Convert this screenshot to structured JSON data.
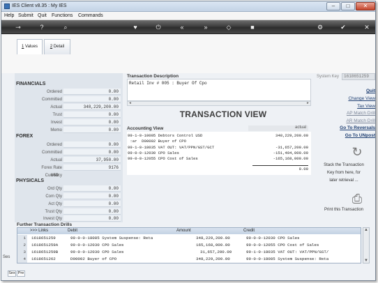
{
  "window": {
    "title": "IES Client v8.35 : My IES"
  },
  "menu": [
    "Help",
    "Submit",
    "Quit",
    "Functions",
    "Commands"
  ],
  "toolbar_icons": [
    "key-icon",
    "help-icon",
    "search-icon",
    "heart-icon",
    "power-icon",
    "rewind-icon",
    "fast-forward-icon",
    "stop-icon",
    "settings-icon",
    "check-icon",
    "close-icon"
  ],
  "tabs": [
    {
      "num": "1",
      "label": "Values",
      "active": true
    },
    {
      "num": "2",
      "label": "Detail",
      "active": false
    }
  ],
  "financials": {
    "heading": "FINANCIALS",
    "fields": [
      {
        "label": "Ordered",
        "value": "0.00"
      },
      {
        "label": "Committed",
        "value": "0.00"
      },
      {
        "label": "Actual",
        "value": "348,229,200.00"
      },
      {
        "label": "Trust",
        "value": "0.00"
      },
      {
        "label": "Invest",
        "value": "0.00"
      },
      {
        "label": "Memo",
        "value": "0.00"
      }
    ]
  },
  "forex": {
    "heading": "FOREX",
    "fields": [
      {
        "label": "Ordered",
        "value": "0.00"
      },
      {
        "label": "Committed",
        "value": "0.00"
      },
      {
        "label": "Actual",
        "value": "37,950.00"
      },
      {
        "label": "Forex Rate",
        "value": "9176"
      },
      {
        "label": "Currency",
        "value": "USD"
      }
    ]
  },
  "physicals": {
    "heading": "PHYSICALS",
    "fields": [
      {
        "label": "Ord Qty",
        "value": "0.00"
      },
      {
        "label": "Com Qty",
        "value": "0.00"
      },
      {
        "label": "Act Qty",
        "value": "0.00"
      },
      {
        "label": "Trust Qty",
        "value": "0.00"
      },
      {
        "label": "Invest Qty",
        "value": "0.00"
      }
    ]
  },
  "transaction": {
    "description_label": "Transaction Description",
    "description": "Retail Inv # 005 : Buyer Of Cpo",
    "view_title": "TRANSACTION VIEW",
    "accounting_label": "Accounting View",
    "actual_header": "actual",
    "lines": [
      {
        "text": "99-1-0-10005 Debtors Control USD",
        "amount": "348,229,200.00"
      },
      {
        "text": " :ar  D00002 Buyer of CPO",
        "amount": ""
      },
      {
        "text": "99-1-0-18035 VAT OUT: VAT/PPN/GST/GCT",
        "amount": "-31,657,200.00"
      },
      {
        "text": "99-0-0-12030 CPO Sales",
        "amount": "-151,404,000.00"
      },
      {
        "text": "99-0-0-12055 CPO Cost of Sales",
        "amount": "-165,168,000.00"
      }
    ],
    "total": "0.00"
  },
  "system_key": {
    "label": "System Key",
    "value": "1618651259"
  },
  "actions": {
    "quit": "Quit",
    "change_view": "Change View",
    "tax_view": "Tax View",
    "ap_match": "AP Match Drill",
    "ar_match": "AR Match Drill",
    "go_reversals": "Go To Reversals",
    "go_unpost": "Go To UNpost",
    "stack_text": [
      "Stack the Transaction",
      "Key from here, for",
      "later retrieval ..."
    ],
    "print_text": "Print this Transaction"
  },
  "drills": {
    "label": "Further Transaction Drills",
    "columns": [
      ">>> Links",
      "Debit",
      "Amount",
      "Credit"
    ],
    "rows": [
      {
        "n": "1",
        "link": "1618651259",
        "debit": "99-0-0-18085 System Suspense: Reta",
        "amount": "348,229,200.00",
        "credit": "99-0-0-12030 CPO Sales"
      },
      {
        "n": "2",
        "link": "1618651259A",
        "debit": "99-0-0-12030 CPO Sales",
        "amount": "165,168,000.00",
        "credit": "99-0-0-12055 CPO Cost of Sales"
      },
      {
        "n": "3",
        "link": "1618651259B",
        "debit": "99-0-0-12030 CPO Sales",
        "amount": "31,657,200.00",
        "credit": "99-1-0-18035 VAT OUT: VAT/PPN/GST/"
      },
      {
        "n": "4",
        "link": "1618651262",
        "debit": "D00002 Buyer of CPO",
        "amount": "348,229,200.00",
        "credit": "99-0-0-18085 System Suspense: Reta"
      }
    ]
  },
  "bottom": {
    "ses_label": "Ses",
    "tabs": [
      "Sex",
      "Pre"
    ]
  }
}
